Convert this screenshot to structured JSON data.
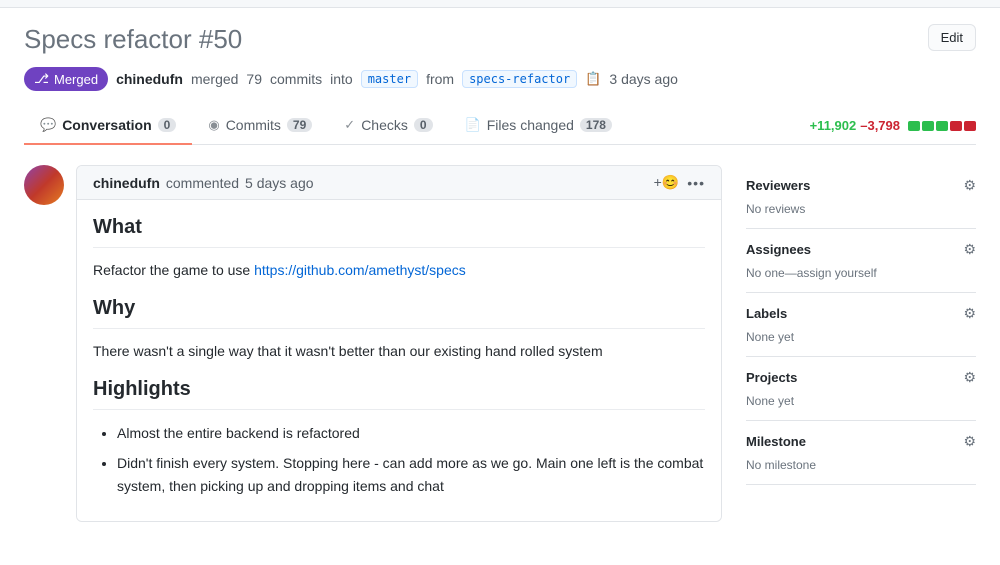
{
  "topbar": {},
  "header": {
    "title": "Specs refactor",
    "pr_number": "#50",
    "edit_button": "Edit"
  },
  "pr_meta": {
    "badge": "Merged",
    "author": "chinedufn",
    "action": "merged",
    "commits_count": "79",
    "commits_word": "commits",
    "into_word": "into",
    "base_branch": "master",
    "from_word": "from",
    "head_branch": "specs-refactor",
    "time": "3 days ago"
  },
  "tabs": [
    {
      "id": "conversation",
      "icon": "💬",
      "label": "Conversation",
      "count": "0",
      "active": true
    },
    {
      "id": "commits",
      "icon": "◉",
      "label": "Commits",
      "count": "79",
      "active": false
    },
    {
      "id": "checks",
      "icon": "✓",
      "label": "Checks",
      "count": "0",
      "active": false
    },
    {
      "id": "files-changed",
      "icon": "📄",
      "label": "Files changed",
      "count": "178",
      "active": false
    }
  ],
  "diff_stats": {
    "additions": "+11,902",
    "deletions": "–3,798",
    "bars": [
      {
        "color": "#2cbe4e"
      },
      {
        "color": "#2cbe4e"
      },
      {
        "color": "#2cbe4e"
      },
      {
        "color": "#cb2431"
      },
      {
        "color": "#cb2431"
      }
    ]
  },
  "comment": {
    "author": "chinedufn",
    "action": "commented",
    "time": "5 days ago",
    "add_reaction": "+😊",
    "more_icon": "•••",
    "sections": [
      {
        "type": "heading",
        "text": "What"
      },
      {
        "type": "paragraph",
        "text": "Refactor the game to use ",
        "link_text": "https://github.com/amethyst/specs",
        "link_href": "https://github.com/amethyst/specs"
      },
      {
        "type": "heading",
        "text": "Why"
      },
      {
        "type": "paragraph",
        "text": "There wasn't a single way that it wasn't better than our existing hand rolled system",
        "link_text": null
      },
      {
        "type": "heading",
        "text": "Highlights"
      },
      {
        "type": "list",
        "items": [
          "Almost the entire backend is refactored",
          "Didn't finish every system. Stopping here - can add more as we go. Main one left is the combat system, then picking up and dropping items and chat"
        ]
      }
    ]
  },
  "sidebar": {
    "sections": [
      {
        "id": "reviewers",
        "title": "Reviewers",
        "value": "No reviews",
        "has_gear": true
      },
      {
        "id": "assignees",
        "title": "Assignees",
        "value": "No one—assign yourself",
        "has_gear": true
      },
      {
        "id": "labels",
        "title": "Labels",
        "value": "None yet",
        "has_gear": true
      },
      {
        "id": "projects",
        "title": "Projects",
        "value": "None yet",
        "has_gear": true
      },
      {
        "id": "milestone",
        "title": "Milestone",
        "value": "No milestone",
        "has_gear": true
      }
    ]
  }
}
